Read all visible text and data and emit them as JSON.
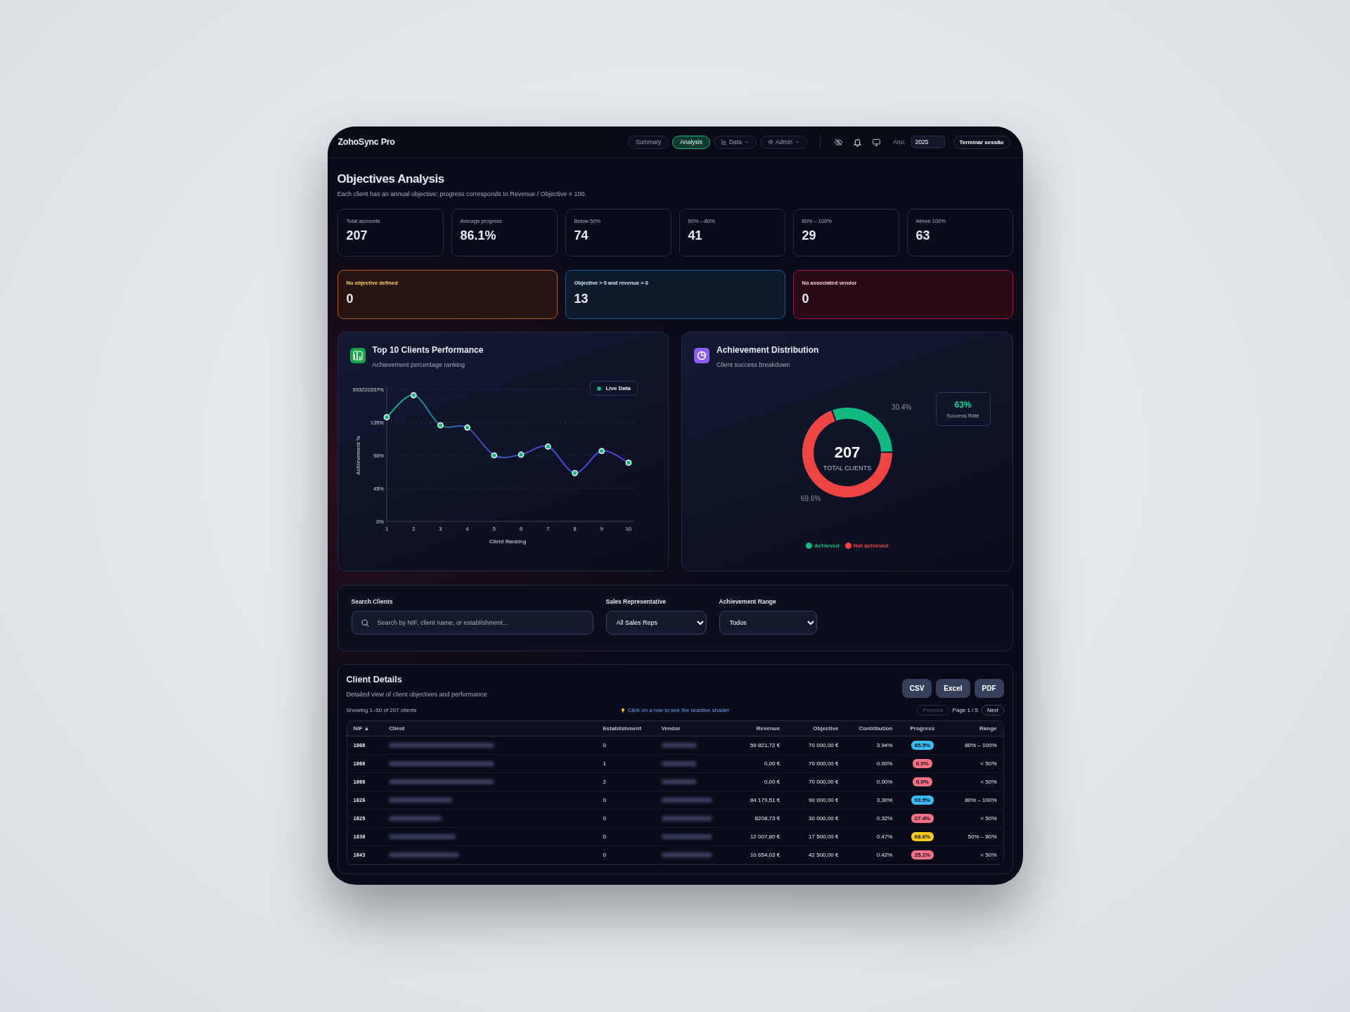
{
  "app": {
    "brand": "ZohoSync Pro"
  },
  "nav": [
    {
      "label": "Summary",
      "selected": false,
      "kind": "plain"
    },
    {
      "label": "Analysis",
      "selected": true,
      "kind": "plain"
    },
    {
      "label": "Data",
      "selected": false,
      "kind": "chart-menu"
    },
    {
      "label": "Admin",
      "selected": false,
      "kind": "gear-menu"
    }
  ],
  "year": {
    "label": "Ano:",
    "value": "2025"
  },
  "logout": "Terminar sessão",
  "page": {
    "title": "Objectives Analysis",
    "subtitle": "Each client has an annual objective; progress corresponds to Revenue / Objective × 100."
  },
  "stats": [
    {
      "label": "Total accounts",
      "value": "207"
    },
    {
      "label": "Average progress",
      "value": "86.1%"
    },
    {
      "label": "Below 50%",
      "value": "74"
    },
    {
      "label": "50% – 80%",
      "value": "41"
    },
    {
      "label": "80% – 100%",
      "value": "29"
    },
    {
      "label": "Above 100%",
      "value": "63"
    }
  ],
  "alerts": [
    {
      "label": "No objective defined",
      "value": "0",
      "kind": "warning"
    },
    {
      "label": "Objective > 0 and revenue = 0",
      "value": "13",
      "kind": "info"
    },
    {
      "label": "No associated vendor",
      "value": "0",
      "kind": "danger"
    }
  ],
  "performance": {
    "title": "Top 10 Clients Performance",
    "subtitle": "Achievement percentage ranking",
    "badge": "Live Data",
    "chart_data": {
      "type": "line",
      "xlabel": "Client Ranking",
      "ylabel": "Achievement %",
      "x": [
        1,
        2,
        3,
        4,
        5,
        6,
        7,
        8,
        9,
        10
      ],
      "series": [
        {
          "color": "#10b981",
          "values": [
            142,
            172,
            131,
            128,
            90,
            91,
            102,
            66,
            96,
            80
          ]
        }
      ],
      "ylim": [
        0,
        180
      ],
      "grid": true,
      "marker": "circle",
      "yticks": [
        {
          "value": 0,
          "label": "0%"
        },
        {
          "value": 45,
          "label": "45%"
        },
        {
          "value": 90,
          "label": "90%"
        },
        {
          "value": 135,
          "label": "135%"
        }
      ]
    },
    "y_top_label": "593220337%"
  },
  "distribution": {
    "title": "Achievement Distribution",
    "subtitle": "Client success breakdown",
    "center_value": "207",
    "center_label": "TOTAL CLIENTS",
    "rate": {
      "value": "63%",
      "label": "Success Rate"
    },
    "legend": [
      {
        "color": "#10b981"
      },
      {
        "color": "#ef4444"
      }
    ],
    "chart_data": {
      "type": "donut",
      "categories": [
        "Achieved",
        "Not achieved"
      ],
      "series": [
        {
          "values": [
            30.4,
            69.6
          ]
        }
      ],
      "value_labels": [
        "30.4%",
        "69.6%"
      ],
      "legend": "bottom"
    }
  },
  "filters": {
    "search": {
      "label": "Search Clients",
      "placeholder": "Search by NIF, client name, or establishment..."
    },
    "rep": {
      "label": "Sales Representative",
      "value": "All Sales Reps"
    },
    "range": {
      "label": "Achievement Range",
      "value": "Todos"
    }
  },
  "table": {
    "title": "Client Details",
    "subtitle": "Detailed view of client objectives and performance",
    "exports": [
      "CSV",
      "Excel",
      "PDF"
    ],
    "showing": "Showing 1–50 of 207 clients",
    "hint": "Click on a row to see the reactive shader",
    "pager": {
      "previous": {
        "label": "Previous",
        "disabled": true
      },
      "page": "Page 1 / 5",
      "next": {
        "label": "Next",
        "disabled": false
      }
    },
    "columns": [
      "NIF ▲",
      "Client",
      "Establishment",
      "Vendor",
      "Revenue",
      "Objective",
      "Contribution",
      "Progress",
      "Range"
    ],
    "rows": [
      {
        "nif": "1008",
        "establishment": "0",
        "revenue": "59 821,72 €",
        "objective": "70 000,00 €",
        "contribution": "3.94%",
        "progress": "85.5%",
        "range": "80% – 100%",
        "color": "#38bdf8"
      },
      {
        "nif": "1008",
        "establishment": "1",
        "revenue": "0,00 €",
        "objective": "70 000,00 €",
        "contribution": "0.00%",
        "progress": "0.0%",
        "range": "< 50%",
        "color": "#fb7185"
      },
      {
        "nif": "1008",
        "establishment": "2",
        "revenue": "0,00 €",
        "objective": "70 000,00 €",
        "contribution": "0.00%",
        "progress": "0.0%",
        "range": "< 50%",
        "color": "#fb7185"
      },
      {
        "nif": "1026",
        "establishment": "0",
        "revenue": "84 179,51 €",
        "objective": "90 000,00 €",
        "contribution": "3.30%",
        "progress": "93.5%",
        "range": "80% – 100%",
        "color": "#38bdf8"
      },
      {
        "nif": "1029",
        "establishment": "0",
        "revenue": "8208,73 €",
        "objective": "30 000,00 €",
        "contribution": "0.32%",
        "progress": "27.4%",
        "range": "< 50%",
        "color": "#fb7185"
      },
      {
        "nif": "1038",
        "establishment": "0",
        "revenue": "12 007,80 €",
        "objective": "17 500,00 €",
        "contribution": "0.47%",
        "progress": "68.6%",
        "range": "50% – 80%",
        "color": "#facc15"
      },
      {
        "nif": "1043",
        "establishment": "0",
        "revenue": "10 654,03 €",
        "objective": "42 500,00 €",
        "contribution": "0.42%",
        "progress": "25.1%",
        "range": "< 50%",
        "color": "#fb7185"
      }
    ]
  }
}
